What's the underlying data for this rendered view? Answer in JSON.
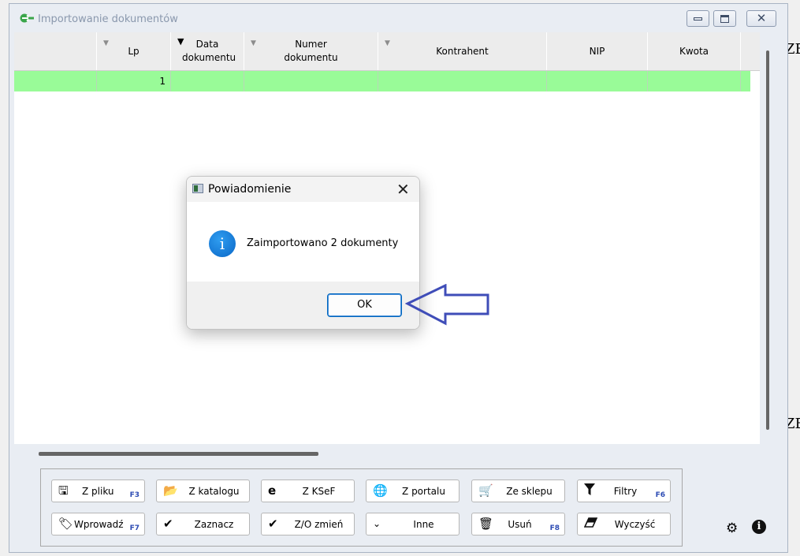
{
  "window": {
    "title": "Importowanie dokumentów"
  },
  "grid": {
    "columns": [
      "Lp",
      "Data dokumentu",
      "Numer dokumentu",
      "Kontrahent",
      "NIP",
      "Kwota"
    ],
    "rows": [
      {
        "lp": "1"
      }
    ]
  },
  "toolbar": {
    "row1": [
      {
        "label": "Z pliku",
        "key": "F3"
      },
      {
        "label": "Z katalogu",
        "key": ""
      },
      {
        "label": "Z KSeF",
        "key": ""
      },
      {
        "label": "Z portalu",
        "key": ""
      },
      {
        "label": "Ze sklepu",
        "key": ""
      },
      {
        "label": "Filtry",
        "key": "F6"
      }
    ],
    "row2": [
      {
        "label": "Wprowadź",
        "key": "F7"
      },
      {
        "label": "Zaznacz",
        "key": ""
      },
      {
        "label": "Z/O zmień",
        "key": ""
      },
      {
        "label": "Inne",
        "key": ""
      },
      {
        "label": "Usuń",
        "key": "F8"
      },
      {
        "label": "Wyczyść",
        "key": ""
      }
    ]
  },
  "background_text": {
    "top": "ZE",
    "bottom": "ZE"
  },
  "dialog": {
    "title": "Powiadomienie",
    "message": "Zaimportowano 2 dokumenty",
    "ok_label": "OK"
  },
  "colors": {
    "selected_row": "#99fb98",
    "accent": "#0067c0",
    "arrow": "#3f4db8",
    "function_key": "#2c4bb3"
  },
  "icons": {
    "title": "import-icon",
    "dialog_info": "info-icon",
    "settings": "gear-icon",
    "about": "info-icon"
  }
}
